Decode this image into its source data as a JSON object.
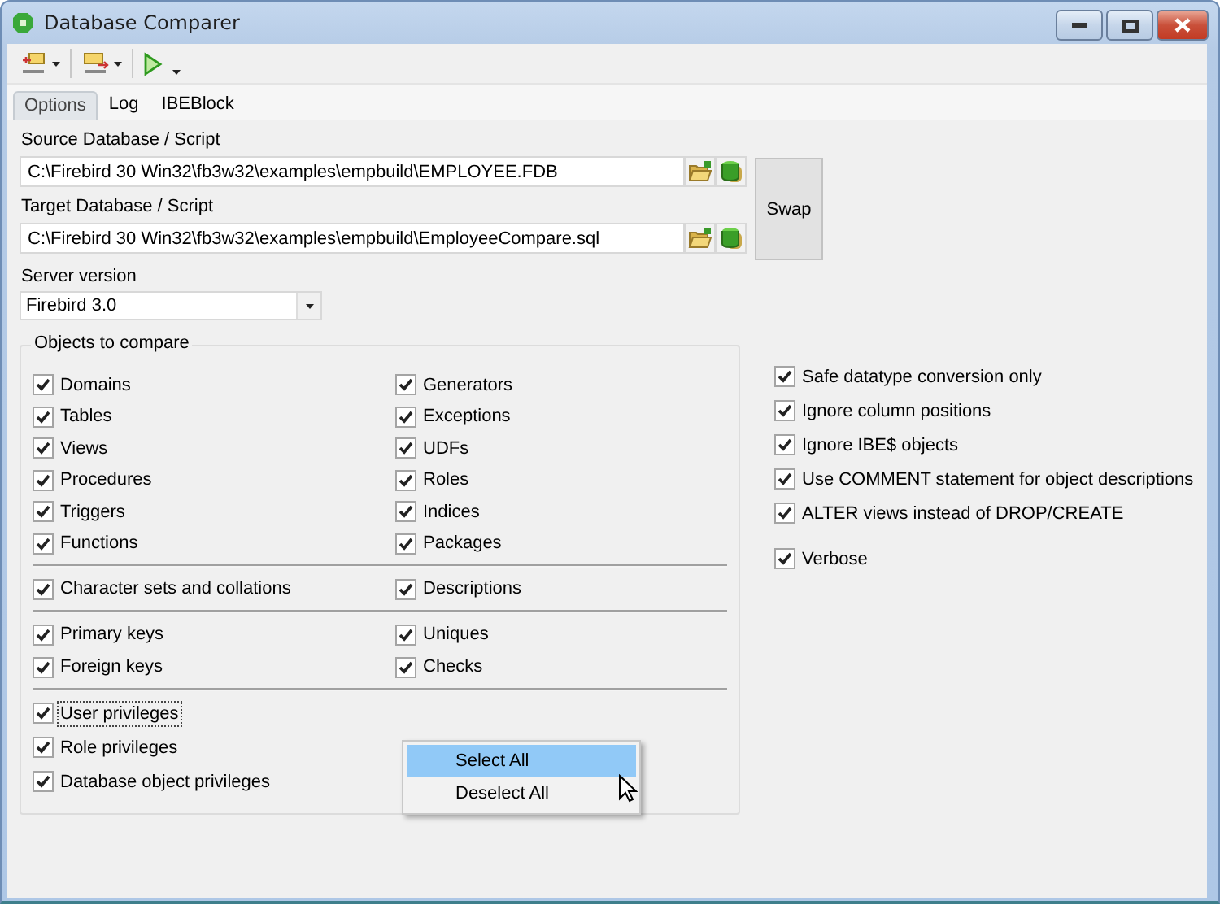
{
  "window": {
    "title": "Database Comparer"
  },
  "tabs": [
    {
      "label": "Options",
      "selected": true
    },
    {
      "label": "Log",
      "selected": false
    },
    {
      "label": "IBEBlock",
      "selected": false
    }
  ],
  "source": {
    "label": "Source Database / Script",
    "value": "C:\\Firebird 30 Win32\\fb3w32\\examples\\empbuild\\EMPLOYEE.FDB"
  },
  "target": {
    "label": "Target Database / Script",
    "value": "C:\\Firebird 30 Win32\\fb3w32\\examples\\empbuild\\EmployeeCompare.sql"
  },
  "swap_button": "Swap",
  "server_version": {
    "label": "Server version",
    "value": "Firebird 3.0"
  },
  "objects_group": {
    "title": "Objects to compare",
    "sections": [
      {
        "columns": [
          [
            {
              "label": "Domains",
              "checked": true
            },
            {
              "label": "Tables",
              "checked": true
            },
            {
              "label": "Views",
              "checked": true
            },
            {
              "label": "Procedures",
              "checked": true
            },
            {
              "label": "Triggers",
              "checked": true
            },
            {
              "label": "Functions",
              "checked": true
            }
          ],
          [
            {
              "label": "Generators",
              "checked": true
            },
            {
              "label": "Exceptions",
              "checked": true
            },
            {
              "label": "UDFs",
              "checked": true
            },
            {
              "label": "Roles",
              "checked": true
            },
            {
              "label": "Indices",
              "checked": true
            },
            {
              "label": "Packages",
              "checked": true
            }
          ]
        ]
      },
      {
        "columns": [
          [
            {
              "label": "Character sets and collations",
              "checked": true
            }
          ],
          [
            {
              "label": "Descriptions",
              "checked": true
            }
          ]
        ]
      },
      {
        "columns": [
          [
            {
              "label": "Primary keys",
              "checked": true
            },
            {
              "label": "Foreign keys",
              "checked": true
            }
          ],
          [
            {
              "label": "Uniques",
              "checked": true
            },
            {
              "label": "Checks",
              "checked": true
            }
          ]
        ]
      },
      {
        "columns": [
          [
            {
              "label": "User privileges",
              "checked": true,
              "focused": true
            },
            {
              "label": "Role privileges",
              "checked": true,
              "focused": false
            },
            {
              "label": "Database object privileges",
              "checked": true,
              "focused": false
            }
          ]
        ]
      }
    ]
  },
  "option_groups": [
    [
      {
        "label": "Safe datatype conversion only",
        "checked": true
      },
      {
        "label": "Ignore column positions",
        "checked": true
      },
      {
        "label": "Ignore IBE$ objects",
        "checked": true
      },
      {
        "label": "Use COMMENT statement for object descriptions",
        "checked": true
      },
      {
        "label": "ALTER views instead of DROP/CREATE",
        "checked": true
      }
    ],
    [
      {
        "label": "Verbose",
        "checked": true
      }
    ]
  ],
  "context_menu": [
    {
      "label": "Select All",
      "selected": true
    },
    {
      "label": "Deselect All",
      "selected": false
    }
  ]
}
